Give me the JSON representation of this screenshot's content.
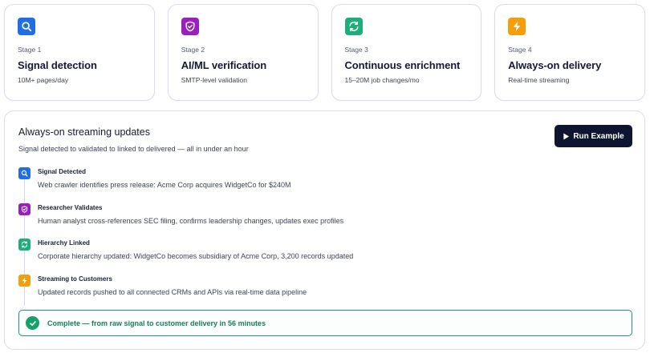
{
  "colors": {
    "blue": "#1f6de8",
    "purple": "#9b1fbf",
    "green": "#1fae7a",
    "orange": "#f59e0b",
    "dark_button": "#0d1530",
    "success": "#16a06a"
  },
  "stages": [
    {
      "number": "Stage 1",
      "title": "Signal detection",
      "subtitle": "10M+ pages/day",
      "icon": "search-icon",
      "color": "#1f6de8"
    },
    {
      "number": "Stage 2",
      "title": "AI/ML verification",
      "subtitle": "SMTP-level validation",
      "icon": "shield-check-icon",
      "color": "#9b1fbf"
    },
    {
      "number": "Stage 3",
      "title": "Continuous enrichment",
      "subtitle": "15–20M job changes/mo",
      "icon": "refresh-icon",
      "color": "#1fae7a"
    },
    {
      "number": "Stage 4",
      "title": "Always-on delivery",
      "subtitle": "Real-time streaming",
      "icon": "lightning-icon",
      "color": "#f59e0b"
    }
  ],
  "panel": {
    "title": "Always-on streaming updates",
    "subtitle": "Signal detected to validated to linked to delivered — all in under an hour",
    "run_button_label": "Run Example"
  },
  "steps": [
    {
      "title": "Signal Detected",
      "description": "Web crawler identifies press release: Acme Corp acquires WidgetCo for $240M",
      "icon": "search-icon"
    },
    {
      "title": "Researcher Validates",
      "description": "Human analyst cross-references SEC filing, confirms leadership changes, updates exec profiles",
      "icon": "shield-check-icon"
    },
    {
      "title": "Hierarchy Linked",
      "description": "Corporate hierarchy updated: WidgetCo becomes subsidiary of Acme Corp, 3,200 records updated",
      "icon": "refresh-icon"
    },
    {
      "title": "Streaming to Customers",
      "description": "Updated records pushed to all connected CRMs and APIs via real-time data pipeline",
      "icon": "lightning-icon"
    }
  ],
  "complete": {
    "text": "Complete — from raw signal to customer delivery in 56 minutes",
    "icon": "check-circle-icon"
  }
}
